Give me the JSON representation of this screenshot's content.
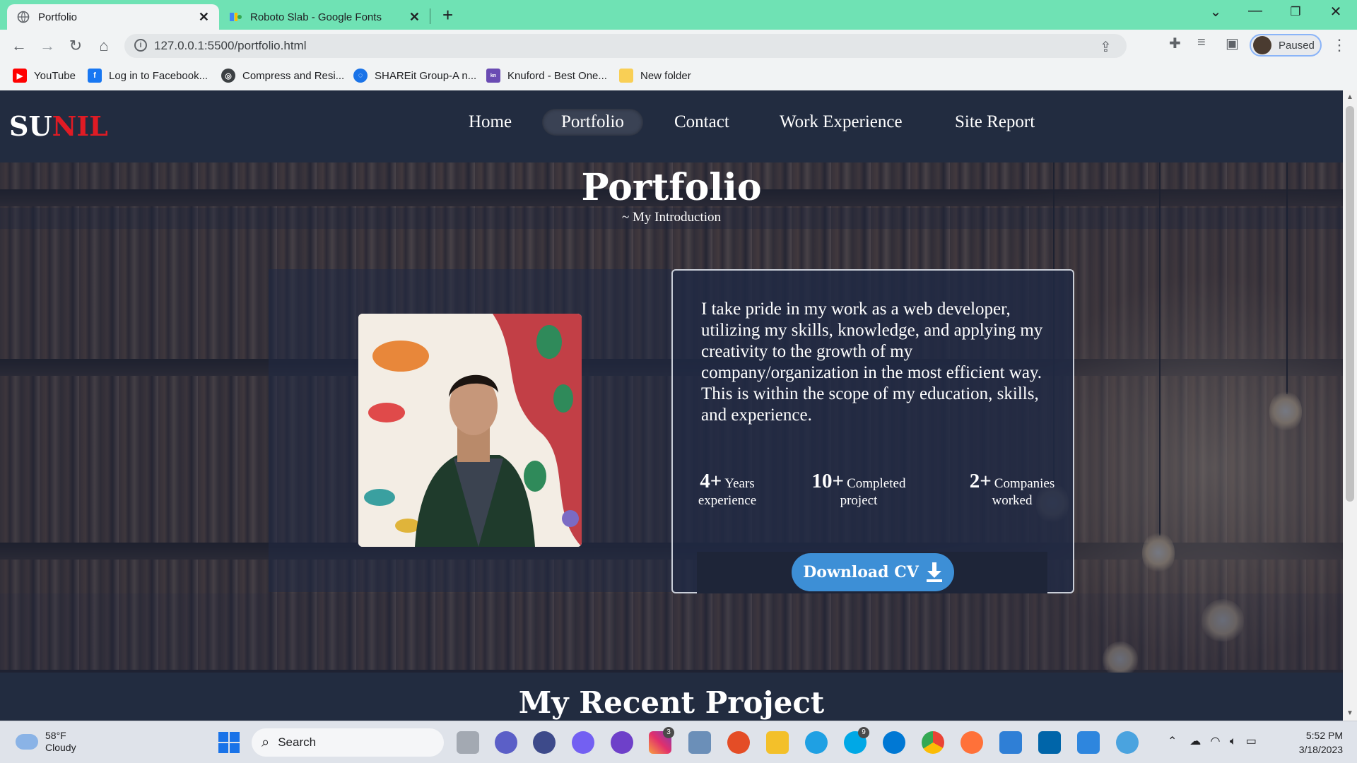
{
  "browser": {
    "tabs": [
      {
        "title": "Portfolio",
        "active": true
      },
      {
        "title": "Roboto Slab - Google Fonts",
        "active": false
      }
    ],
    "url": "127.0.0.1:5500/portfolio.html",
    "profile_label": "Paused",
    "bookmarks": [
      {
        "label": "YouTube",
        "icon": "youtube-icon"
      },
      {
        "label": "Log in to Facebook...",
        "icon": "facebook-icon"
      },
      {
        "label": "Compress and Resi...",
        "icon": "globe-icon"
      },
      {
        "label": "SHAREit Group-A n...",
        "icon": "shareit-icon"
      },
      {
        "label": "Knuford - Best One...",
        "icon": "knuford-icon"
      },
      {
        "label": "New folder",
        "icon": "folder-icon"
      }
    ]
  },
  "site": {
    "logo": {
      "part1": "SU",
      "part2": "NIL"
    },
    "nav": [
      "Home",
      "Portfolio",
      "Contact",
      "Work Experience",
      "Site Report"
    ],
    "active_nav": "Portfolio",
    "title": "Portfolio",
    "subtitle": "~ My Introduction",
    "intro": "I take pride in my work as a web developer, utilizing my skills, knowledge, and applying my creativity to the growth of my company/organization in the most efficient way. This is within the scope of my education, skills, and experience.",
    "stats": [
      {
        "num": "4+",
        "label_a": "Years",
        "label_b": "experience"
      },
      {
        "num": "10+",
        "label_a": "Completed",
        "label_b": "project"
      },
      {
        "num": "2+",
        "label_a": "Companies",
        "label_b": "worked"
      }
    ],
    "download_label": "Download CV",
    "next_section": "My Recent Project"
  },
  "taskbar": {
    "weather_temp": "58°F",
    "weather_desc": "Cloudy",
    "search_label": "Search",
    "time": "5:52 PM",
    "date": "3/18/2023",
    "badges": {
      "skype": "9",
      "instagram": "3"
    }
  },
  "colors": {
    "tabbar": "#6fe2b4",
    "site_nav": "#222c40",
    "logo_accent": "#e01b24",
    "download_button": "#3d8fd6"
  }
}
